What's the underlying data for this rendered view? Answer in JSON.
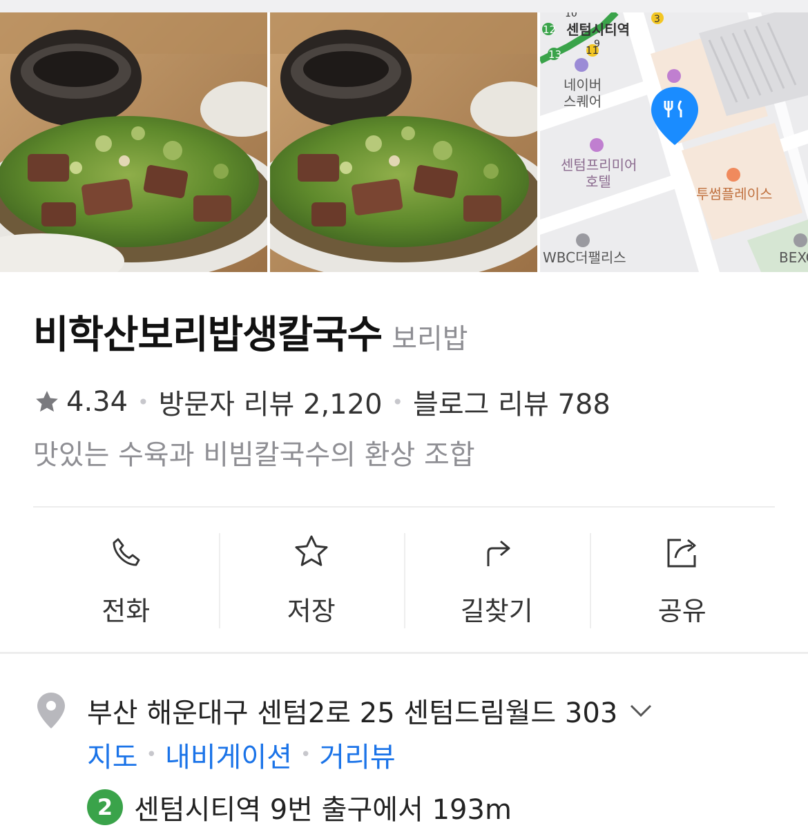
{
  "place": {
    "name": "비학산보리밥생칼국수",
    "category": "보리밥",
    "rating": "4.34",
    "visitor_reviews": "방문자 리뷰 2,120",
    "blog_reviews": "블로그 리뷰 788",
    "description": "맛있는 수육과 비빔칼국수의 환상 조합"
  },
  "map": {
    "labels": {
      "station": "센텀시티역",
      "naver_square": "네이버\n스퀘어",
      "hotel": "센텀프리미어\n호텔",
      "twosome": "투썸플레이스",
      "wbc": "WBC더팰리스",
      "bexco": "BEXC",
      "exit_12": "12",
      "exit_13": "13",
      "exit_11": "11",
      "exit_10": "10",
      "exit_9": "9",
      "exit_3": "3"
    },
    "pin_color": "#1a8cff"
  },
  "actions": [
    {
      "label": "전화",
      "icon": "phone-icon"
    },
    {
      "label": "저장",
      "icon": "star-outline-icon"
    },
    {
      "label": "길찾기",
      "icon": "directions-icon"
    },
    {
      "label": "공유",
      "icon": "share-icon"
    }
  ],
  "address": {
    "text": "부산 해운대구 센텀2로 25 센텀드림월드 303",
    "links": [
      "지도",
      "내비게이션",
      "거리뷰"
    ],
    "subway_line": "2",
    "subway_line_color": "#3aa34a",
    "subway_text": "센텀시티역 9번 출구에서 193m"
  },
  "colors": {
    "link": "#1a73e8",
    "muted": "#8e8e93"
  }
}
